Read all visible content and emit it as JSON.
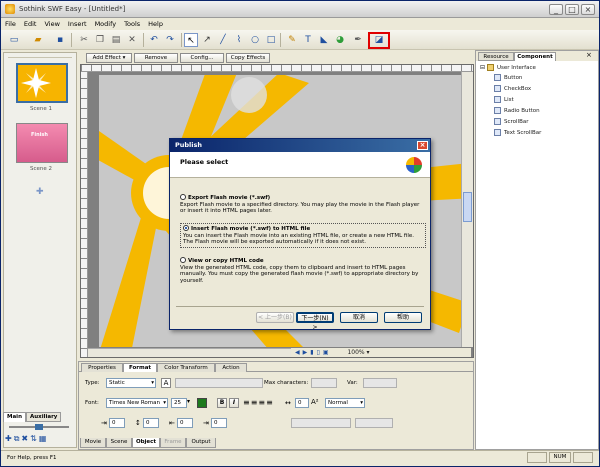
{
  "window": {
    "title": "Sothink SWF Easy - [Untitled*]",
    "controls": [
      "_",
      "□",
      "×"
    ]
  },
  "menu": [
    "File",
    "Edit",
    "View",
    "Insert",
    "Modify",
    "Tools",
    "Help"
  ],
  "scenes": [
    {
      "label": "Scene 1"
    },
    {
      "label": "Scene 2",
      "thumb_text": "Finish"
    }
  ],
  "left_tabs": [
    "Main",
    "Auxiliary"
  ],
  "effects_bar": {
    "add": "Add Effect",
    "remove": "Remove",
    "config": "Config...",
    "copy": "Copy Effects"
  },
  "zoom": "100%",
  "right_panel": {
    "tabs": [
      "Resource",
      "Component"
    ],
    "root": "User Interface",
    "items": [
      "Button",
      "CheckBox",
      "List",
      "Radio Button",
      "ScrollBar",
      "Text ScrollBar"
    ]
  },
  "properties": {
    "tabs": [
      "Properties",
      "Format",
      "Color Transform",
      "Action"
    ],
    "type_label": "Type:",
    "type_value": "Static",
    "max_chars_label": "Max characters:",
    "var_label": "Var:",
    "font_label": "Font:",
    "font_value": "Times New Roman",
    "size_value": "25",
    "spacing_value": "0",
    "style_value": "Normal",
    "bold": "B",
    "italic": "I",
    "indent_values": [
      "0",
      "0",
      "0",
      "0"
    ]
  },
  "bottom_tabs": [
    "Movie",
    "Scene",
    "Object",
    "Frame",
    "Output"
  ],
  "status": {
    "help": "For Help, press F1",
    "cap": "NUM"
  },
  "dialog": {
    "title": "Publish",
    "header": "Please select",
    "options": [
      {
        "title": "Export Flash movie (*.swf)",
        "desc": "Export Flash movie to a specified directory. You may play the movie in the Flash player or insert it into HTML pages later."
      },
      {
        "title": "Insert Flash movie (*.swf) to HTML file",
        "desc": "You can insert the Flash movie into an existing HTML file, or create a new HTML file. The Flash movie will be exported automatically if it does not exist."
      },
      {
        "title": "View or copy HTML code",
        "desc": "View the generated HTML code, copy them to clipboard and insert to HTML pages manually. You must copy the generated flash movie (*.swf) to appropriate directory by yourself."
      }
    ],
    "buttons": {
      "back": "< 上一步(B)",
      "next": "下一步(N) >",
      "cancel": "取消",
      "help": "帮助"
    }
  },
  "colors": {
    "accent": "#0a246a",
    "highlight": "#e00000",
    "star": "#f5b800"
  }
}
